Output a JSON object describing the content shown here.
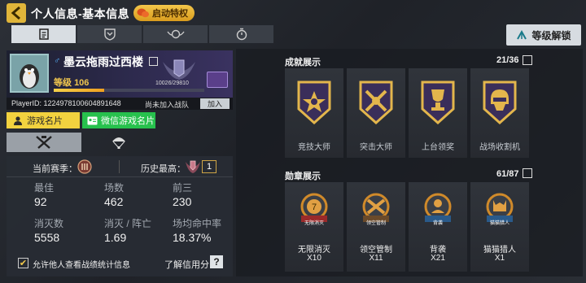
{
  "header": {
    "title": "个人信息-基本信息",
    "privilege_label": "启动特权",
    "level_unlock_label": "等级解锁"
  },
  "tabs": [
    {
      "icon": "profile-icon",
      "active": true
    },
    {
      "icon": "shield-icon",
      "active": false
    },
    {
      "icon": "rank-wings-icon",
      "active": false
    },
    {
      "icon": "stopwatch-icon",
      "active": false
    }
  ],
  "profile": {
    "name": "墨云拖雨过西楼",
    "level_label": "等级",
    "level": "106",
    "xp_current": "10026",
    "xp_total": "29810",
    "xp_progress": 0.336,
    "player_id": "PlayerID: 1224978100604891648",
    "team_status": "尚未加入战队",
    "join_label": "加入",
    "game_card_label": "游戏名片",
    "wechat_card_label": "微信游戏名片"
  },
  "stats": {
    "current_season_label": "当前赛季：",
    "history_best_label": "历史最高：",
    "history_best_value": "1",
    "items": [
      {
        "label": "最佳",
        "value": "92"
      },
      {
        "label": "场数",
        "value": "462"
      },
      {
        "label": "前三",
        "value": "230"
      },
      {
        "label": "消灭数",
        "value": "5558"
      },
      {
        "label": "消灭 / 阵亡",
        "value": "1.69"
      },
      {
        "label": "场均命中率",
        "value": "18.37%"
      }
    ],
    "share_text": "允许他人查看战绩统计信息",
    "credit_link": "了解信用分",
    "help": "?"
  },
  "achievements": {
    "title": "成就展示",
    "count": "21/36",
    "items": [
      {
        "label": "竞技大师",
        "icon": "cross-medal-badge-icon"
      },
      {
        "label": "突击大师",
        "icon": "crossed-rifles-badge-icon"
      },
      {
        "label": "上台领奖",
        "icon": "trophy-badge-icon"
      },
      {
        "label": "战场收割机",
        "icon": "skull-helmet-badge-icon"
      }
    ]
  },
  "medals": {
    "title": "勋章展示",
    "count": "61/87",
    "items": [
      {
        "name": "无限消灭",
        "tag": "无限消灭",
        "count": "X10"
      },
      {
        "name": "领空管制",
        "tag": "领空管制",
        "count": "X11"
      },
      {
        "name": "背袭",
        "tag": "背袭",
        "count": "X21"
      },
      {
        "name": "猫猫猎人",
        "tag": "猫猫猎人",
        "count": "X1"
      }
    ]
  },
  "colors": {
    "accent_gold": "#f2c94c",
    "green": "#27c14d",
    "panel": "#2a2e35"
  }
}
